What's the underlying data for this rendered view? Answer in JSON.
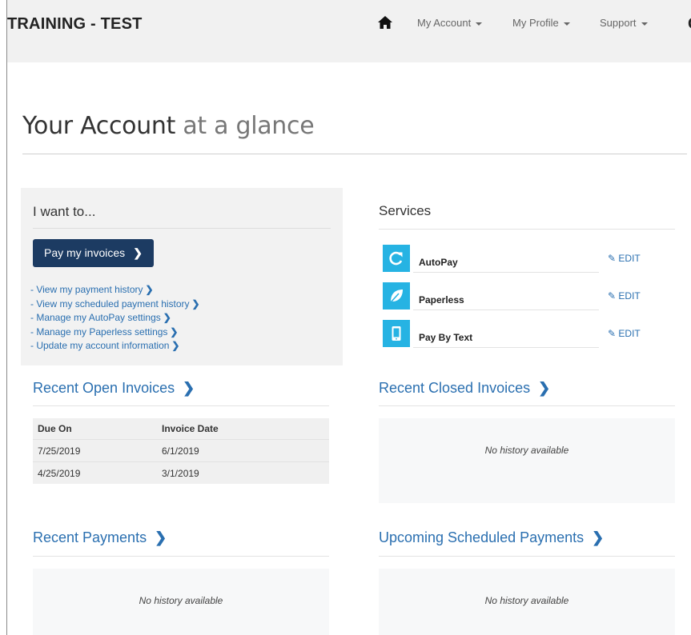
{
  "navbar": {
    "brand": "TRAINING - TEST",
    "home_icon": "home-icon",
    "items": [
      {
        "label": "My Account"
      },
      {
        "label": "My Profile"
      },
      {
        "label": "Support"
      }
    ],
    "cut_label": "G"
  },
  "page": {
    "title_main": "Your Account",
    "title_sub": " at a glance"
  },
  "iwant": {
    "title": "I want to...",
    "pay_button": "Pay my invoices",
    "links": [
      "- View my payment history",
      "- View my scheduled payment history",
      "- Manage my AutoPay settings",
      "- Manage my Paperless settings",
      "- Update my account information"
    ]
  },
  "services": {
    "title": "Services",
    "edit_label": "EDIT",
    "items": [
      {
        "label": "AutoPay",
        "icon": "refresh-icon"
      },
      {
        "label": "Paperless",
        "icon": "leaf-icon"
      },
      {
        "label": "Pay By Text",
        "icon": "mobile-phone-icon"
      }
    ]
  },
  "recent_open_invoices": {
    "title": "Recent Open Invoices",
    "columns": [
      "Due On",
      "Invoice Date"
    ],
    "rows": [
      [
        "7/25/2019",
        "6/1/2019"
      ],
      [
        "4/25/2019",
        "3/1/2019"
      ]
    ]
  },
  "recent_closed_invoices": {
    "title": "Recent Closed Invoices",
    "empty": "No history available"
  },
  "recent_payments": {
    "title": "Recent Payments",
    "empty": "No history available"
  },
  "upcoming_scheduled_payments": {
    "title": "Upcoming Scheduled Payments",
    "empty": "No history available"
  },
  "colors": {
    "accent": "#2a6fb0",
    "primary_button": "#1c3b62",
    "service_icon": "#26b3e3"
  }
}
